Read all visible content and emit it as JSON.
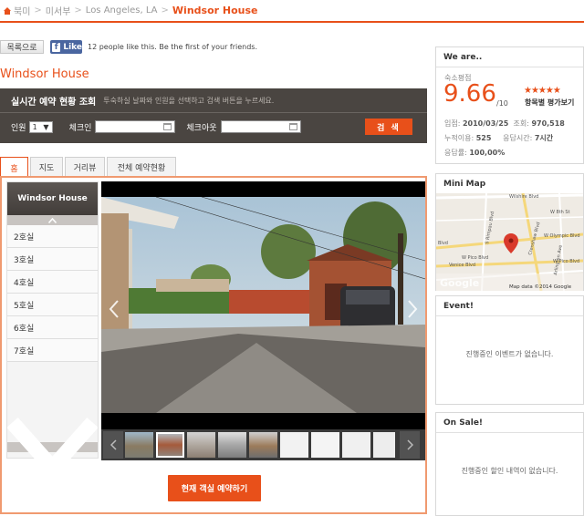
{
  "breadcrumb": {
    "home": "북미",
    "region": "미서부",
    "city": "Los Angeles, LA",
    "current": "Windsor House"
  },
  "toolbar": {
    "list_label": "목록으로",
    "fb_like_label": "Like",
    "fb_text": "12 people like this. Be the first of your friends."
  },
  "page_title": "Windsor House",
  "search": {
    "title": "실시간 예약 현황 조회",
    "desc": "투숙하실 날짜와 인원을 선택하고 검색 버튼을 누르세요.",
    "guests_label": "인원",
    "guests_value": "1",
    "checkin_label": "체크인",
    "checkout_label": "체크아웃",
    "search_label": "검 색"
  },
  "tabs": [
    {
      "label": "홈"
    },
    {
      "label": "지도"
    },
    {
      "label": "거리뷰"
    },
    {
      "label": "전체 예약현황"
    }
  ],
  "rooms": {
    "header": "Windsor House",
    "items": [
      "2호실",
      "3호실",
      "4호실",
      "5호실",
      "6호실",
      "7호실"
    ]
  },
  "reserve_label": "현재 객실 예약하기",
  "about": {
    "title": "We are..",
    "rating_label": "숙소평점",
    "rating_value": "9.66",
    "rating_max": "/10",
    "rating_link": "항목별 평가보기",
    "stars": "★★★★★",
    "joined_label": "입점",
    "joined_value": "2010/03/25",
    "views_label": "조회",
    "views_value": "970,518",
    "uses_label": "누적이용",
    "uses_value": "525",
    "response_time_label": "응답시간",
    "response_time_value": "7시간",
    "response_rate_label": "응답률",
    "response_rate_value": "100,00%"
  },
  "minimap": {
    "title": "Mini Map",
    "attribution": "Map data ©2014 Google",
    "streets": [
      "Wilshire Blvd",
      "S Rimpau Blvd",
      "Crenshaw Blvd",
      "W 8th St",
      "W Olympic Blvd",
      "W Pico Blvd",
      "Venice Blvd",
      "Arlington Ave",
      "W Pico Blvd",
      "Blvd"
    ]
  },
  "event": {
    "title": "Event!",
    "message": "진행중인 이벤트가 없습니다."
  },
  "sale": {
    "title": "On Sale!",
    "message": "진행중인 할인 내역이 없습니다."
  },
  "colors": {
    "accent": "#e8501a",
    "panel_dark": "#4a4541"
  }
}
